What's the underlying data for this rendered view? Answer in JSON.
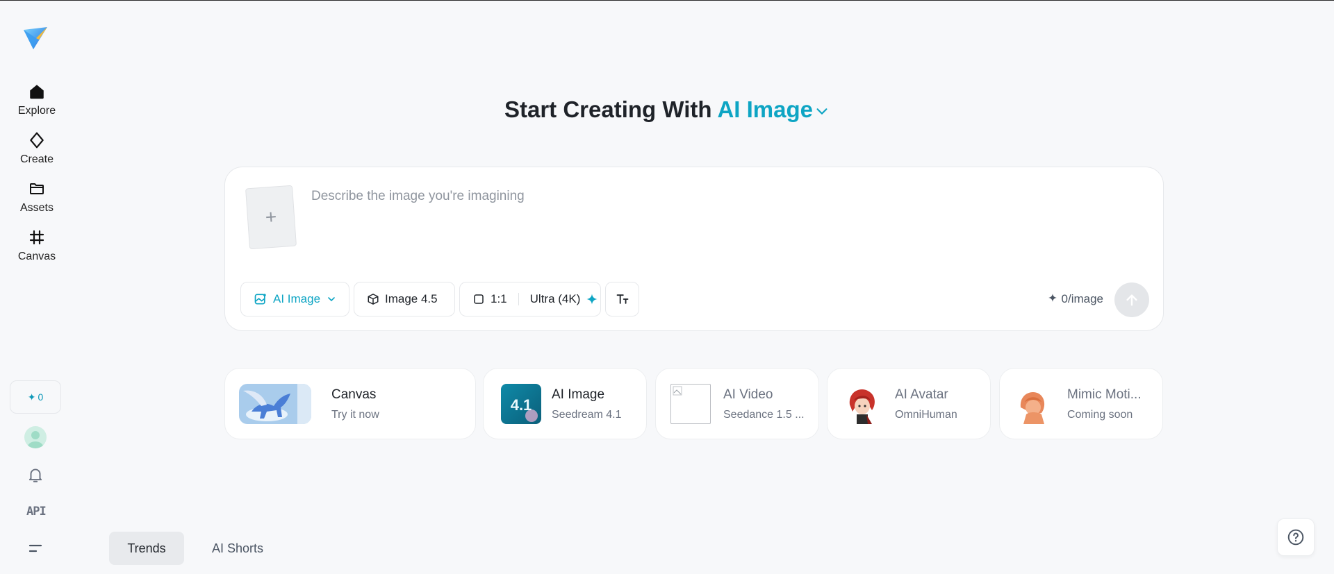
{
  "sidebar": {
    "nav": [
      {
        "label": "Explore",
        "icon": "home-icon"
      },
      {
        "label": "Create",
        "icon": "diamond-icon"
      },
      {
        "label": "Assets",
        "icon": "folder-icon"
      },
      {
        "label": "Canvas",
        "icon": "frame-icon"
      }
    ],
    "credits": "0",
    "api_label": "API"
  },
  "heading": {
    "prefix": "Start Creating With",
    "accent": "AI Image"
  },
  "prompt": {
    "placeholder": "Describe the image you're imagining",
    "value": "",
    "upload_glyph": "+",
    "mode_label": "AI Image",
    "model_label": "Image 4.5",
    "ratio_label": "1:1",
    "quality_label": "Ultra (4K)",
    "cost_label": "0/image"
  },
  "cards": [
    {
      "title": "Canvas",
      "subtitle": "Try it now"
    },
    {
      "title": "AI Image",
      "subtitle": "Seedream 4.1",
      "badge": "4.1"
    },
    {
      "title": "AI Video",
      "subtitle": "Seedance 1.5 ..."
    },
    {
      "title": "AI Avatar",
      "subtitle": "OmniHuman"
    },
    {
      "title": "Mimic Moti...",
      "subtitle": "Coming soon"
    }
  ],
  "tabs": [
    {
      "label": "Trends",
      "active": true
    },
    {
      "label": "AI Shorts",
      "active": false
    }
  ],
  "colors": {
    "accent": "#0ea5c4",
    "text": "#1f2329",
    "muted": "#6b7280",
    "background": "#f7f8fa"
  }
}
